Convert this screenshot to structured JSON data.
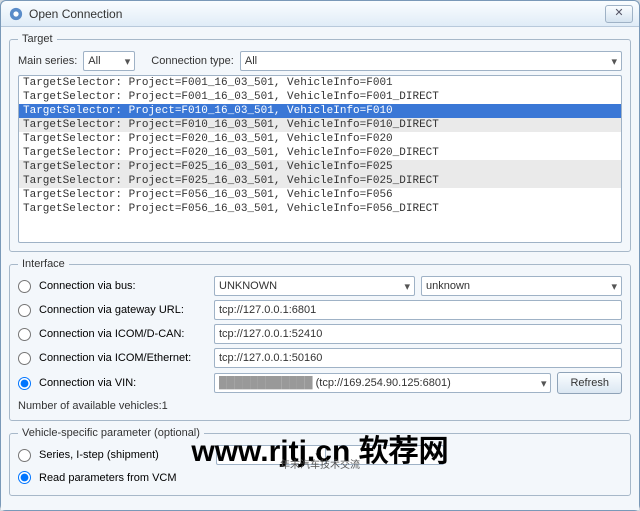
{
  "window": {
    "title": "Open Connection",
    "close_glyph": "✕"
  },
  "target": {
    "legend": "Target",
    "main_series_label": "Main series:",
    "main_series_value": "All",
    "conn_type_label": "Connection type:",
    "conn_type_value": "All",
    "rows": [
      {
        "text": "TargetSelector: Project=F001_16_03_501, VehicleInfo=F001",
        "selected": false,
        "alt": false
      },
      {
        "text": "TargetSelector: Project=F001_16_03_501, VehicleInfo=F001_DIRECT",
        "selected": false,
        "alt": false
      },
      {
        "text": "TargetSelector: Project=F010_16_03_501, VehicleInfo=F010",
        "selected": true,
        "alt": false
      },
      {
        "text": "TargetSelector: Project=F010_16_03_501, VehicleInfo=F010_DIRECT",
        "selected": false,
        "alt": true
      },
      {
        "text": "TargetSelector: Project=F020_16_03_501, VehicleInfo=F020",
        "selected": false,
        "alt": false
      },
      {
        "text": "TargetSelector: Project=F020_16_03_501, VehicleInfo=F020_DIRECT",
        "selected": false,
        "alt": false
      },
      {
        "text": "TargetSelector: Project=F025_16_03_501, VehicleInfo=F025",
        "selected": false,
        "alt": true
      },
      {
        "text": "TargetSelector: Project=F025_16_03_501, VehicleInfo=F025_DIRECT",
        "selected": false,
        "alt": true
      },
      {
        "text": "TargetSelector: Project=F056_16_03_501, VehicleInfo=F056",
        "selected": false,
        "alt": false
      },
      {
        "text": "TargetSelector: Project=F056_16_03_501, VehicleInfo=F056_DIRECT",
        "selected": false,
        "alt": false
      }
    ]
  },
  "iface": {
    "legend": "Interface",
    "bus_label": "Connection via bus:",
    "bus_sel1": "UNKNOWN",
    "bus_sel2": "unknown",
    "gw_label": "Connection via gateway URL:",
    "gw_value": "tcp://127.0.0.1:6801",
    "icomd_label": "Connection via ICOM/D-CAN:",
    "icomd_value": "tcp://127.0.0.1:52410",
    "icome_label": "Connection via ICOM/Ethernet:",
    "icome_value": "tcp://127.0.0.1:50160",
    "vin_label": "Connection via VIN:",
    "vin_value": "",
    "vin_suffix": "(tcp://169.254.90.125:6801)",
    "refresh": "Refresh",
    "count_label": "Number of available vehicles:1"
  },
  "vsp": {
    "legend": "Vehicle-specific parameter (optional)",
    "series_label": "Series, I-step (shipment)",
    "series_sel1": "",
    "series_sel2": "",
    "vcm_label": "Read parameters from VCM"
  },
  "watermark": {
    "main": "www.rjtj.cn 软荐网",
    "sub": "年末汽车技术交流"
  }
}
